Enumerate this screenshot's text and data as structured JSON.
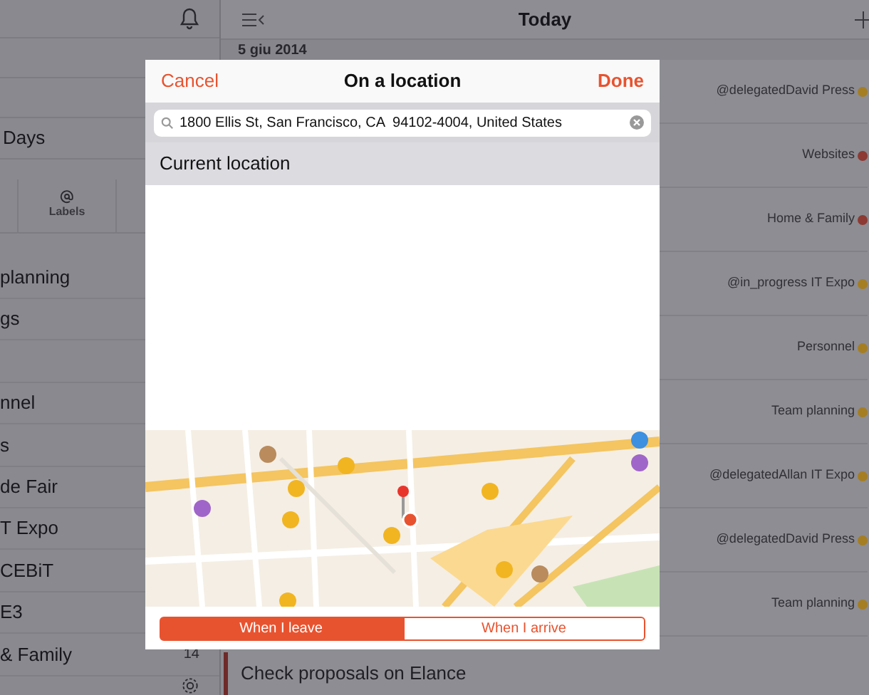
{
  "sidebar": {
    "top_items": [
      {
        "label": "Days"
      }
    ],
    "tabs": [
      {
        "label": "Labels"
      }
    ],
    "items": [
      {
        "label": "planning"
      },
      {
        "label": "gs",
        "gap_after": true
      },
      {
        "label": "nnel"
      },
      {
        "label": "s"
      },
      {
        "label": "de Fair"
      },
      {
        "label": "T Expo"
      },
      {
        "label": "CEBiT"
      },
      {
        "label": "E3"
      },
      {
        "label": "& Family",
        "count": "14"
      }
    ]
  },
  "main": {
    "title": "Today",
    "date": "5 giu 2014",
    "rows": [
      {
        "tags": "@delegatedDavid Press",
        "color": "#a57e24"
      },
      {
        "tags": "Websites",
        "color": "#8c3a33"
      },
      {
        "tags": "Home & Family",
        "color": "#8c3a33"
      },
      {
        "tags": "@in_progress IT Expo",
        "color": "#a57e24"
      },
      {
        "tags": "Personnel",
        "color": "#a57e24"
      },
      {
        "tags": "Team planning",
        "color": "#a57e24"
      },
      {
        "tags": "@delegatedAllan IT Expo",
        "color": "#a57e24"
      },
      {
        "tags": "@delegatedDavid Press",
        "color": "#a57e24"
      },
      {
        "tags": "Team planning",
        "color": "#a57e24"
      }
    ],
    "task": "Check proposals on Elance"
  },
  "dialog": {
    "title": "On a location",
    "cancel": "Cancel",
    "done": "Done",
    "search": {
      "value": "1800 Ellis St, San Francisco, CA  94102-4004, United States"
    },
    "suggestion": "Current location",
    "trigger": [
      {
        "label": "When I leave",
        "selected": true
      },
      {
        "label": "When I arrive",
        "selected": false
      }
    ]
  }
}
